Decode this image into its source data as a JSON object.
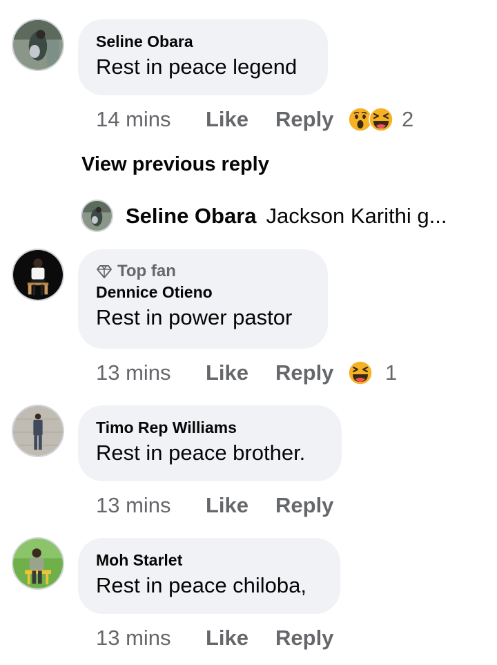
{
  "comments": [
    {
      "author": "Seline Obara",
      "text": "Rest in peace legend",
      "time": "14 mins",
      "like": "Like",
      "reply": "Reply",
      "reactions": [
        "wow",
        "haha"
      ],
      "reaction_count": "2"
    },
    {
      "badge": "Top fan",
      "author": "Dennice Otieno",
      "text": "Rest in power pastor",
      "time": "13 mins",
      "like": "Like",
      "reply": "Reply",
      "reactions": [
        "haha"
      ],
      "reaction_count": "1"
    },
    {
      "author": "Timo Rep Williams",
      "text": "Rest in peace brother.",
      "time": "13 mins",
      "like": "Like",
      "reply": "Reply"
    },
    {
      "author": "Moh Starlet",
      "text": "Rest in peace chiloba,",
      "time": "13 mins",
      "like": "Like",
      "reply": "Reply"
    }
  ],
  "view_previous_reply": "View previous reply",
  "reply_preview": {
    "author": "Seline Obara",
    "text": "Jackson Karithi g..."
  },
  "icons": {
    "badge": "diamond-icon",
    "reaction_wow": "wow-reaction-icon",
    "reaction_haha": "haha-reaction-icon"
  },
  "colors": {
    "bubble": "#f0f2f5",
    "secondary_text": "#65676b",
    "primary_text": "#050505",
    "reaction_yellow": "#f7b125"
  }
}
